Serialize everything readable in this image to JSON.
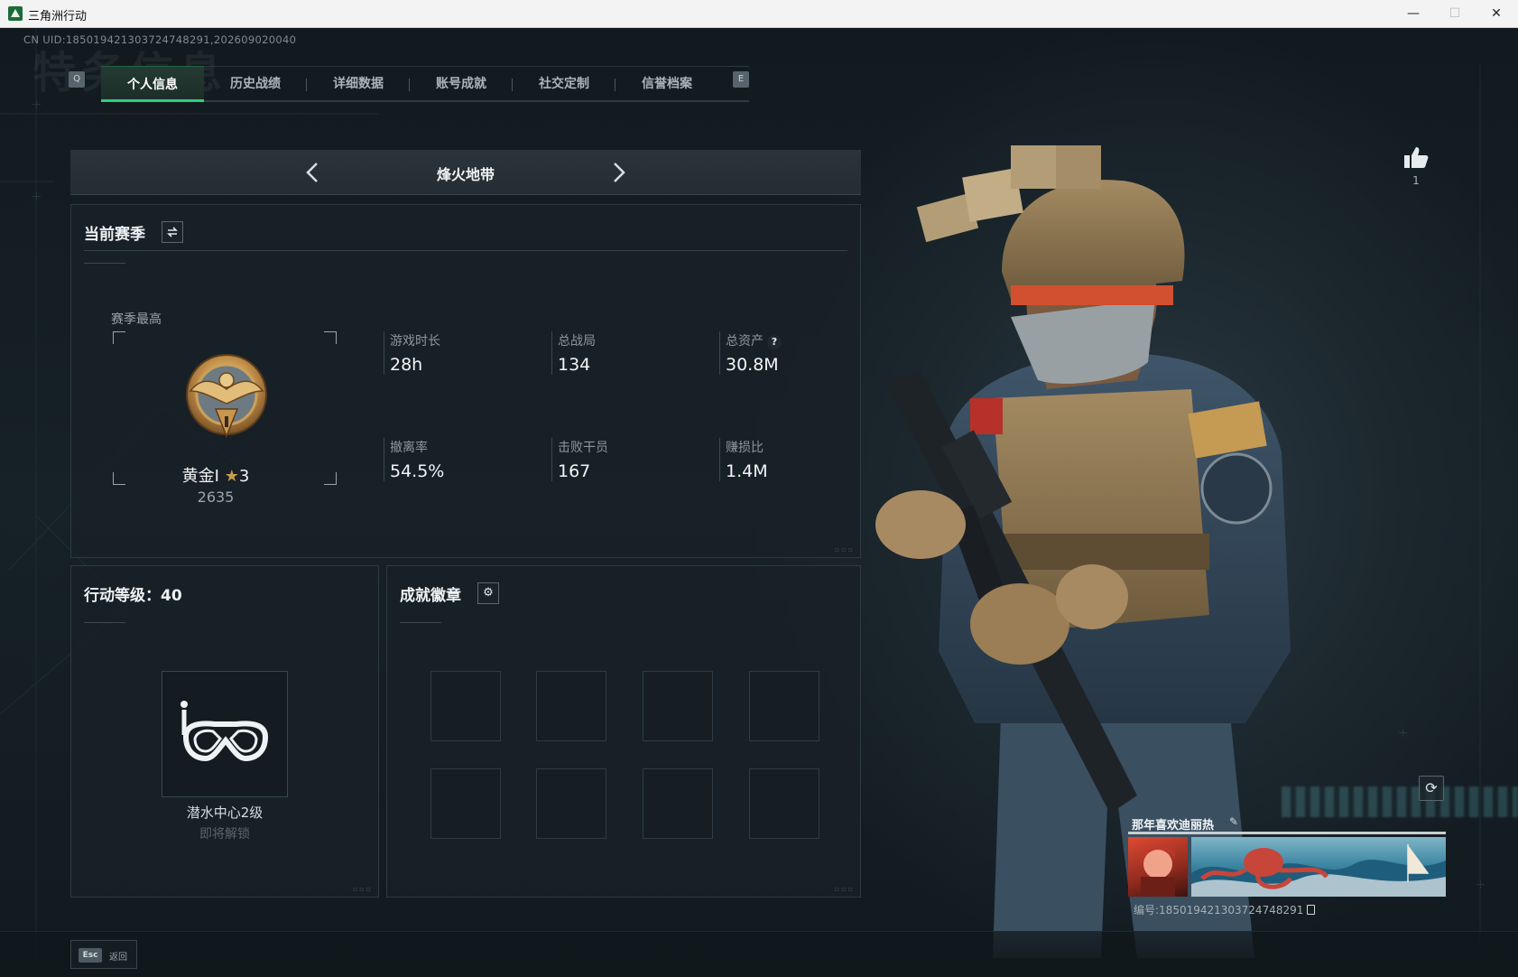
{
  "window": {
    "title": "三角洲行动",
    "minimize": "—",
    "maximize": "☐",
    "close": "✕"
  },
  "uid_line": "CN UID:185019421303724748291,202609020040",
  "bg_title": "特务信息",
  "tabs": {
    "prev_key": "Q",
    "next_key": "E",
    "items": [
      {
        "label": "个人信息",
        "active": true
      },
      {
        "label": "历史战绩",
        "active": false
      },
      {
        "label": "详细数据",
        "active": false
      },
      {
        "label": "账号成就",
        "active": false
      },
      {
        "label": "社交定制",
        "active": false
      },
      {
        "label": "信誉档案",
        "active": false
      }
    ]
  },
  "mode": {
    "title": "烽火地带"
  },
  "season": {
    "title": "当前赛季",
    "best_label": "赛季最高",
    "rank_name": "黄金I",
    "rank_stars": "3",
    "rank_score": "2635",
    "stats": [
      {
        "label": "游戏时长",
        "value": "28h"
      },
      {
        "label": "总战局",
        "value": "134"
      },
      {
        "label": "总资产",
        "value": "30.8M",
        "help": "?"
      },
      {
        "label": "撤离率",
        "value": "54.5%"
      },
      {
        "label": "击败干员",
        "value": "167"
      },
      {
        "label": "赚损比",
        "value": "1.4M"
      }
    ]
  },
  "level": {
    "title": "行动等级：40",
    "unlock_name": "潜水中心2级",
    "unlock_status": "即将解锁"
  },
  "badges": {
    "title": "成就徽章",
    "slots": 8
  },
  "likes": {
    "count": "1"
  },
  "namecard": {
    "name": "那年喜欢迪丽热",
    "id_line": "编号:185019421303724748291"
  },
  "bottom": {
    "esc_key": "Esc",
    "esc_label": "返回"
  },
  "colors": {
    "accent": "#2bd07a",
    "panel_bg": "#182127",
    "gold": "#c99a4f"
  }
}
